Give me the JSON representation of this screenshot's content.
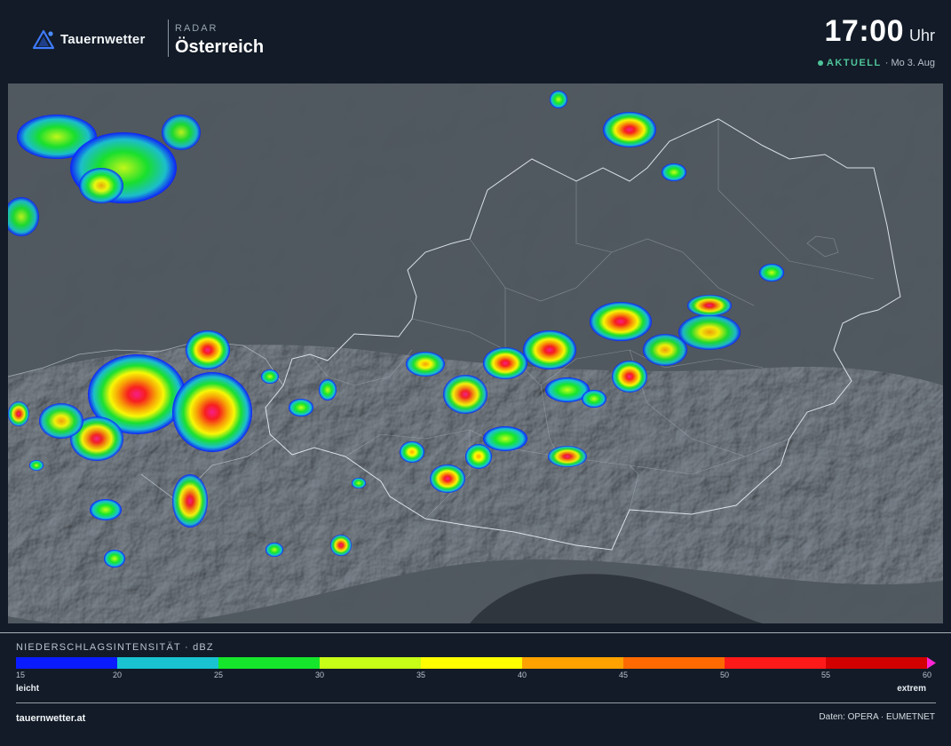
{
  "header": {
    "brand": "Tauernwetter",
    "logo_icon": "mountain-triangle-icon",
    "radar_label": "RADAR",
    "region": "Österreich",
    "time": "17:00",
    "time_unit": "Uhr",
    "status": "AKTUELL",
    "date": "· Mo 3. Aug",
    "status_color": "#4fc49a"
  },
  "map": {
    "description_icon": "radar-map",
    "background_color": "#3a4149"
  },
  "legend": {
    "title": "NIEDERSCHLAGSINTENSITÄT · dBZ",
    "ticks": [
      "15",
      "20",
      "25",
      "30",
      "35",
      "40",
      "45",
      "50",
      "55",
      "60"
    ],
    "colors": [
      "#0a1cff",
      "#19c3d1",
      "#16e62b",
      "#c7ff16",
      "#ffff00",
      "#ffa200",
      "#ff6a00",
      "#ff1a1a",
      "#d30000"
    ],
    "arrow_color": "#ff25d4",
    "low_label": "leicht",
    "high_label": "extrem"
  },
  "footer": {
    "site": "tauernwetter.at",
    "source": "Daten: OPERA · EUMETNET"
  }
}
